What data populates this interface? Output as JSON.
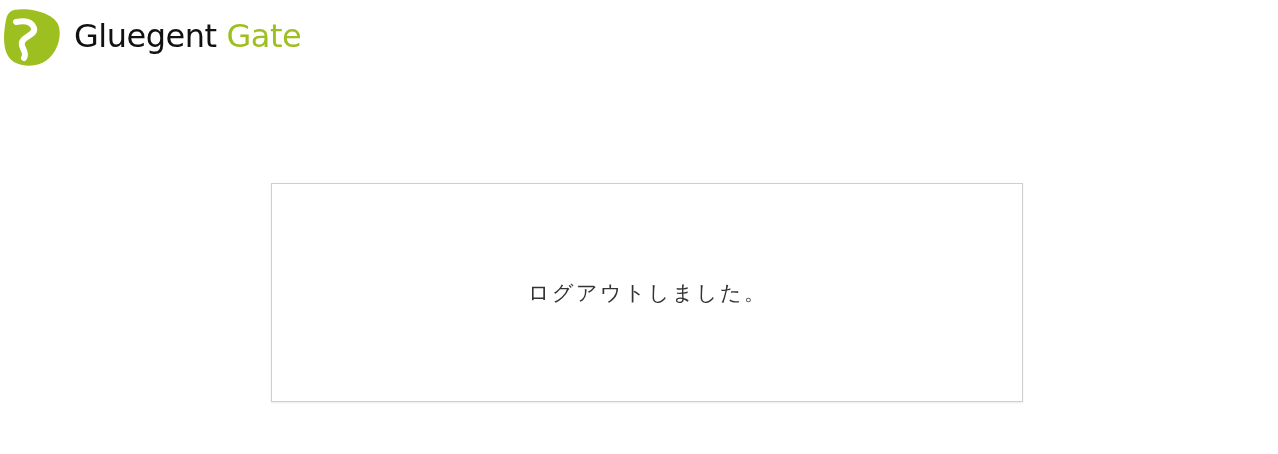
{
  "logo": {
    "brand": "Gluegent",
    "product": "Gate"
  },
  "message": "ログアウトしました。"
}
